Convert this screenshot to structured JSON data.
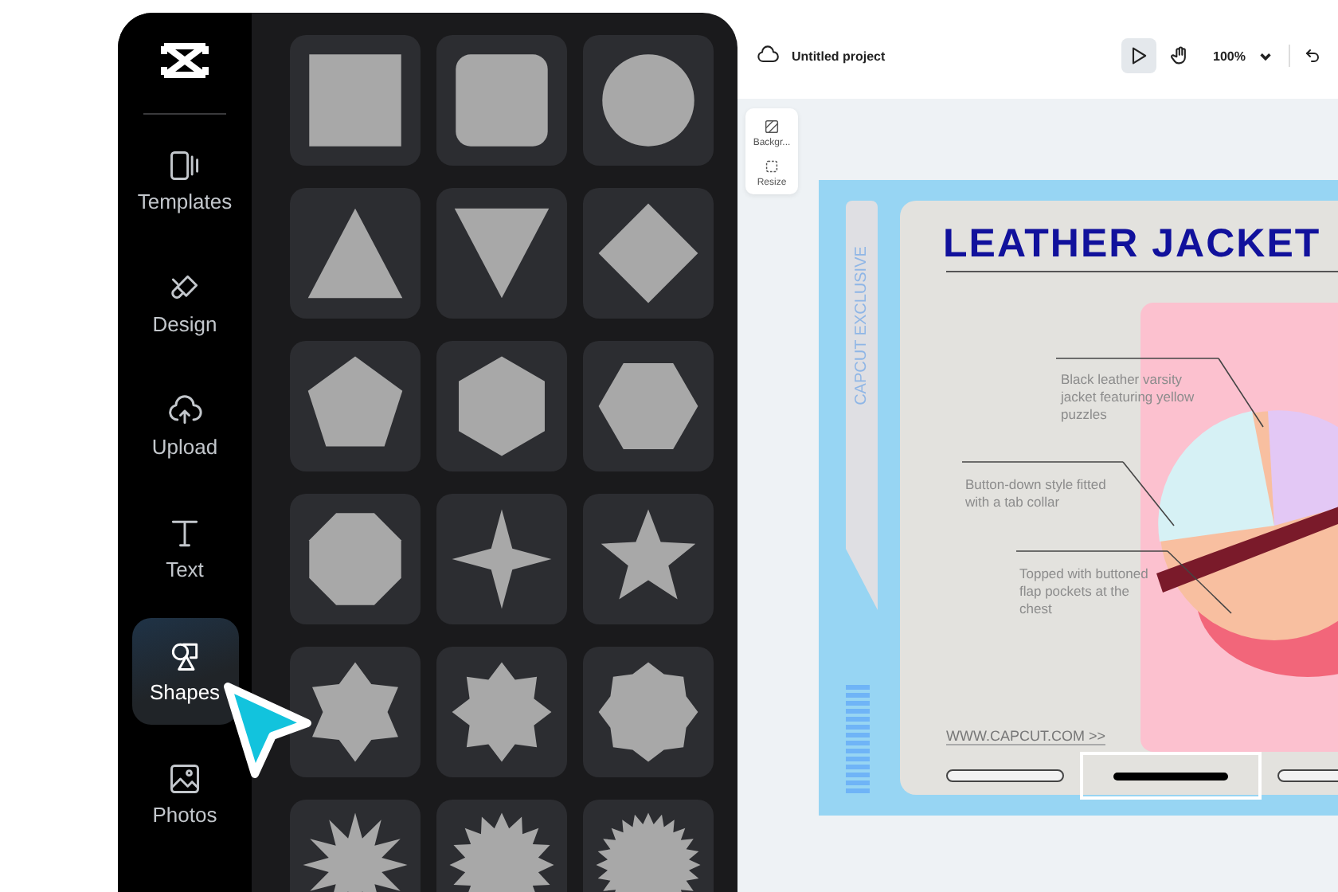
{
  "sidebar": {
    "items": [
      {
        "label": "Templates",
        "selected": false
      },
      {
        "label": "Design",
        "selected": false
      },
      {
        "label": "Upload",
        "selected": false
      },
      {
        "label": "Text",
        "selected": false
      },
      {
        "label": "Shapes",
        "selected": true
      },
      {
        "label": "Photos",
        "selected": false
      }
    ]
  },
  "shape_tiles": [
    {
      "kind": "square"
    },
    {
      "kind": "rounded-square"
    },
    {
      "kind": "circle"
    },
    {
      "kind": "triangle"
    },
    {
      "kind": "inverted-triangle"
    },
    {
      "kind": "diamond"
    },
    {
      "kind": "pentagon"
    },
    {
      "kind": "hexagon"
    },
    {
      "kind": "flat-hexagon"
    },
    {
      "kind": "octagon"
    },
    {
      "kind": "star-4"
    },
    {
      "kind": "star-5"
    },
    {
      "kind": "star-6"
    },
    {
      "kind": "star-8"
    },
    {
      "kind": "seal-8"
    },
    {
      "kind": "burst-12"
    },
    {
      "kind": "burst-16"
    },
    {
      "kind": "burst-24"
    }
  ],
  "editor": {
    "project_title": "Untitled project",
    "tools": [
      {
        "kind": "pointer",
        "selected": true
      },
      {
        "kind": "hand",
        "selected": false
      }
    ],
    "zoom": "100%",
    "side_tools": [
      {
        "label": "Backgr..."
      },
      {
        "label": "Resize"
      }
    ]
  },
  "poster": {
    "side_text": "CAPCUT EXCLUSIVE",
    "title": "LEATHER JACKET",
    "annotations": [
      "Black leather varsity jacket featuring yellow puzzles",
      "Button-down style fitted with a tab collar",
      "Topped with buttoned flap pockets at the chest"
    ],
    "url": "WWW.CAPCUT.COM >>",
    "pages": [
      {
        "selected": false
      },
      {
        "selected": true
      },
      {
        "selected": false
      }
    ]
  }
}
